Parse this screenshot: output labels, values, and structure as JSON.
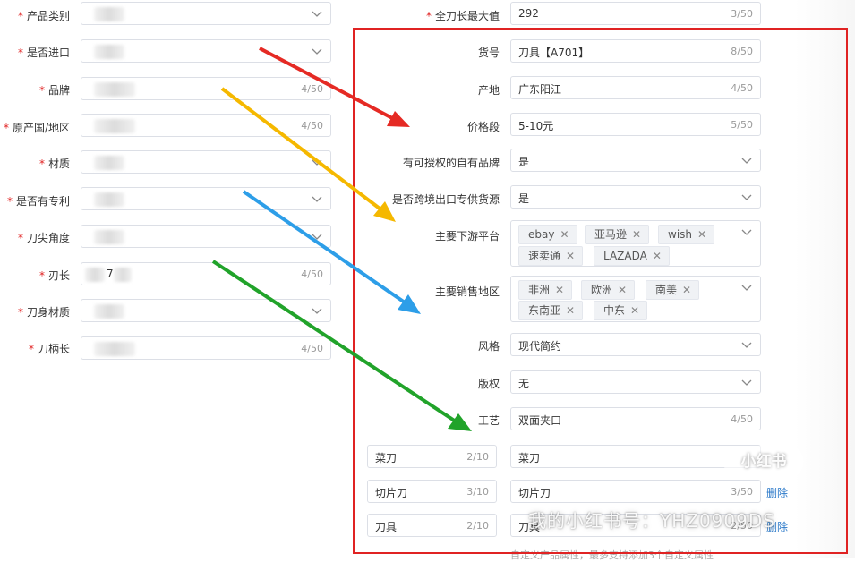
{
  "left_form": {
    "product_category": {
      "label": "产品类别"
    },
    "is_imported": {
      "label": "是否进口"
    },
    "brand": {
      "label": "品牌",
      "counter": "4/50"
    },
    "origin": {
      "label": "原产国/地区",
      "counter": "4/50"
    },
    "material": {
      "label": "材质"
    },
    "has_patent": {
      "label": "是否有专利"
    },
    "tip_angle": {
      "label": "刀尖角度"
    },
    "blade_length": {
      "label": "刃长",
      "value": "7",
      "counter": "4/50"
    },
    "blade_material": {
      "label": "刀身材质"
    },
    "handle_length": {
      "label": "刀柄长",
      "counter": "4/50"
    }
  },
  "right_form": {
    "total_length_max": {
      "label": "全刀长最大值",
      "value": "292",
      "counter": "3/50"
    },
    "item_no": {
      "label": "货号",
      "value": "刀具【A701】",
      "counter": "8/50"
    },
    "origin_place": {
      "label": "产地",
      "value": "广东阳江",
      "counter": "4/50"
    },
    "price_range": {
      "label": "价格段",
      "value": "5-10元",
      "counter": "5/50"
    },
    "authorized_brand": {
      "label": "有可授权的自有品牌",
      "value": "是"
    },
    "cross_border_exclusive": {
      "label": "是否跨境出口专供货源",
      "value": "是"
    },
    "downstream_platforms": {
      "label": "主要下游平台",
      "tags": [
        "ebay",
        "亚马逊",
        "wish",
        "速卖通",
        "LAZADA"
      ]
    },
    "sales_regions": {
      "label": "主要销售地区",
      "tags": [
        "非洲",
        "欧洲",
        "南美",
        "东南亚",
        "中东"
      ]
    },
    "style": {
      "label": "风格",
      "value": "现代简约"
    },
    "copyright": {
      "label": "版权",
      "value": "无"
    },
    "craft": {
      "label": "工艺",
      "value": "双面夹口",
      "counter": "4/50"
    }
  },
  "custom_attributes": [
    {
      "name": "菜刀",
      "name_counter": "2/10",
      "value": "菜刀",
      "value_counter": ""
    },
    {
      "name": "切片刀",
      "name_counter": "3/10",
      "value": "切片刀",
      "value_counter": "3/50",
      "delete": "删除"
    },
    {
      "name": "刀具",
      "name_counter": "2/10",
      "value": "刀具",
      "value_counter": "2/50",
      "delete": "删除"
    }
  ],
  "hint_text": "自定义产品属性，最多支持添加3个自定义属性",
  "watermark": {
    "logo": "小红书",
    "text": "我的小红书号：YHZ0909DS"
  },
  "colors": {
    "required": "#e02020",
    "highlight_box": "#e02323",
    "arrow_red": "#e52a24",
    "arrow_yellow": "#f5b800",
    "arrow_blue": "#2d9ee8",
    "arrow_green": "#21a32a"
  },
  "icons": {
    "dropdown": "chevron-down-icon",
    "tag_remove": "close-icon"
  }
}
